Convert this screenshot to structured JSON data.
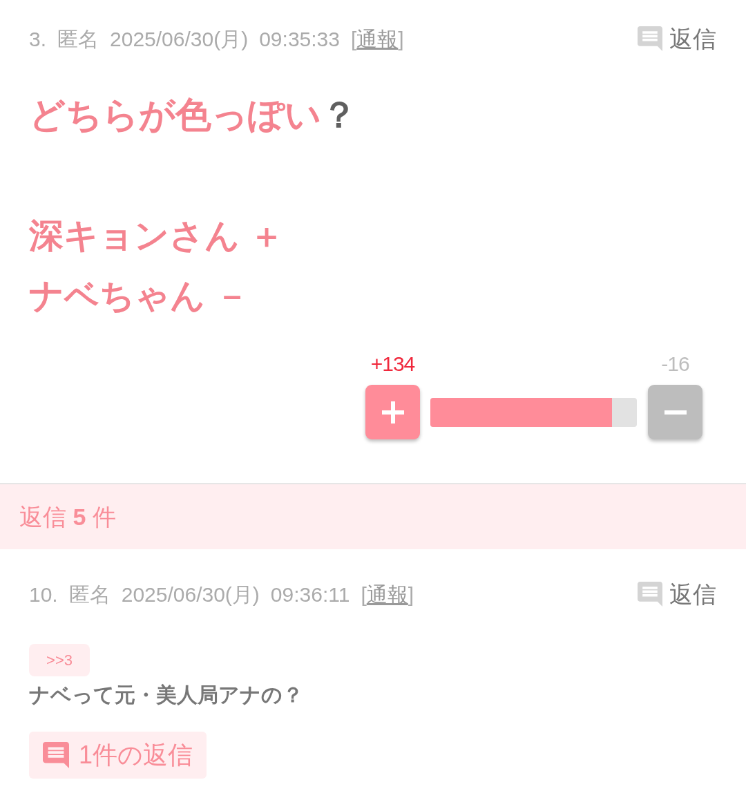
{
  "post": {
    "number": "3.",
    "author": "匿名",
    "date": "2025/06/30(月)",
    "time": "09:35:33",
    "report": {
      "open": "[",
      "label": "通報",
      "close": "]"
    },
    "reply_button": "返信",
    "title": {
      "text": "どちらが色っぽい",
      "mark": "？"
    },
    "options": [
      "深キョンさん ＋",
      "ナベちゃん －"
    ],
    "vote": {
      "plus": "+134",
      "minus": "-16",
      "level": 0.88
    }
  },
  "replies_header": "返信 **5** 件",
  "replies": [
    {
      "number": "10.",
      "author": "匿名",
      "date": "2025/06/30(月)",
      "time": "09:36:11",
      "report": {
        "open": "[",
        "label": "通報",
        "close": "]"
      },
      "reply_button": "返信",
      "anchor": ">>3",
      "body": "ナベって元・美人局アナの？",
      "reply_count_button": "1件の返信"
    }
  ]
}
